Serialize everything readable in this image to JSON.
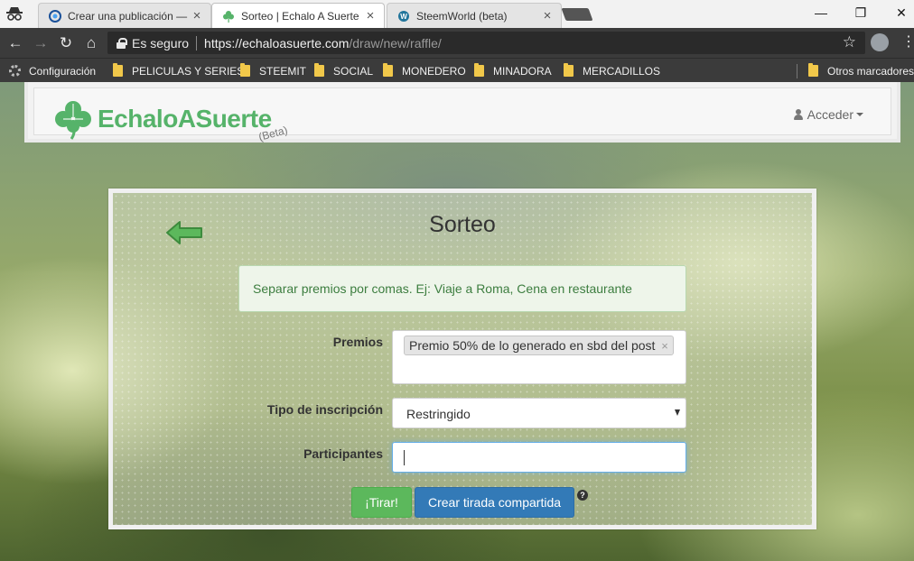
{
  "browser": {
    "tabs": [
      {
        "title": "Crear una publicación —",
        "active": false
      },
      {
        "title": "Sorteo | Echalo A Suerte",
        "active": true
      },
      {
        "title": "SteemWorld (beta)",
        "active": false
      }
    ],
    "close_glyph": "×",
    "window_controls": {
      "minimize": "—",
      "restore": "❐",
      "close": "✕"
    },
    "security_label": "Es seguro",
    "url_host": "https://echaloasuerte.com",
    "url_path": "/draw/new/raffle/",
    "bookmarks": [
      {
        "label": "Configuración",
        "icon": "gear-icon"
      },
      {
        "label": "PELICULAS Y SERIES",
        "icon": "folder-icon"
      },
      {
        "label": "STEEMIT",
        "icon": "folder-icon"
      },
      {
        "label": "SOCIAL",
        "icon": "folder-icon"
      },
      {
        "label": "MONEDERO",
        "icon": "folder-icon"
      },
      {
        "label": "MINADORA",
        "icon": "folder-icon"
      },
      {
        "label": "MERCADILLOS",
        "icon": "folder-icon"
      },
      {
        "label": "Otros marcadores",
        "icon": "folder-icon"
      }
    ]
  },
  "site": {
    "brand_name": "EchaloASuerte",
    "brand_badge": "(Beta)",
    "login_label": "Acceder",
    "brand_color": "#56b36a"
  },
  "raffle": {
    "title": "Sorteo",
    "help_alert": "Separar premios por comas. Ej: Viaje a Roma, Cena en restaurante",
    "prizes_label": "Premios",
    "prize_tags": [
      "Premio 50% de lo generado en sbd del post"
    ],
    "tag_remove": "×",
    "registration_label": "Tipo de inscripción",
    "registration_value": "Restringido",
    "participants_label": "Participantes",
    "participants_value": "",
    "toss_button": "¡Tirar!",
    "shared_button": "Crear tirada compartida",
    "help_glyph": "?"
  }
}
